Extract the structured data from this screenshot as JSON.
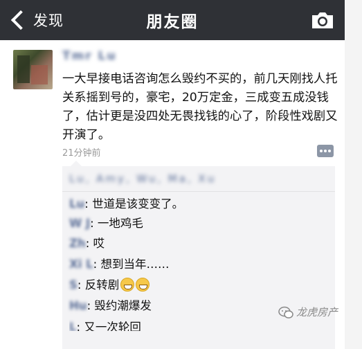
{
  "header": {
    "back_label": "发现",
    "title": "朋友圈"
  },
  "post": {
    "username": "Tmr Lu",
    "text": "一大早接电话咨询怎么毁约不买的，前几天刚找人托关系摇到号的，豪宅，20万定金，三成变五成没钱了，估计更是没四处无畏找钱的心了，阶段性戏剧又开演了。",
    "time_ago": "21分钟前"
  },
  "likes": {
    "names_blurred": "Lu, Amy, Wu, Ma, Xu"
  },
  "comments": [
    {
      "author": "Lu",
      "text": "世道是该变变了。"
    },
    {
      "author": "W J",
      "text": "一地鸡毛"
    },
    {
      "author": "Zh",
      "text": "哎"
    },
    {
      "author": "Xi L",
      "text": "想到当年……"
    },
    {
      "author": "S",
      "text": "反转剧",
      "emojis": [
        "grin-emoji",
        "grin-emoji"
      ]
    },
    {
      "author": "Hu",
      "text": "毁约潮爆发"
    },
    {
      "author": "L",
      "text": "又一次轮回"
    }
  ],
  "watermark": {
    "text": "龙虎房产"
  },
  "colors": {
    "header_bg": "#2f3136",
    "link_blue": "#576b95",
    "comment_bg": "#f3f3f5"
  }
}
